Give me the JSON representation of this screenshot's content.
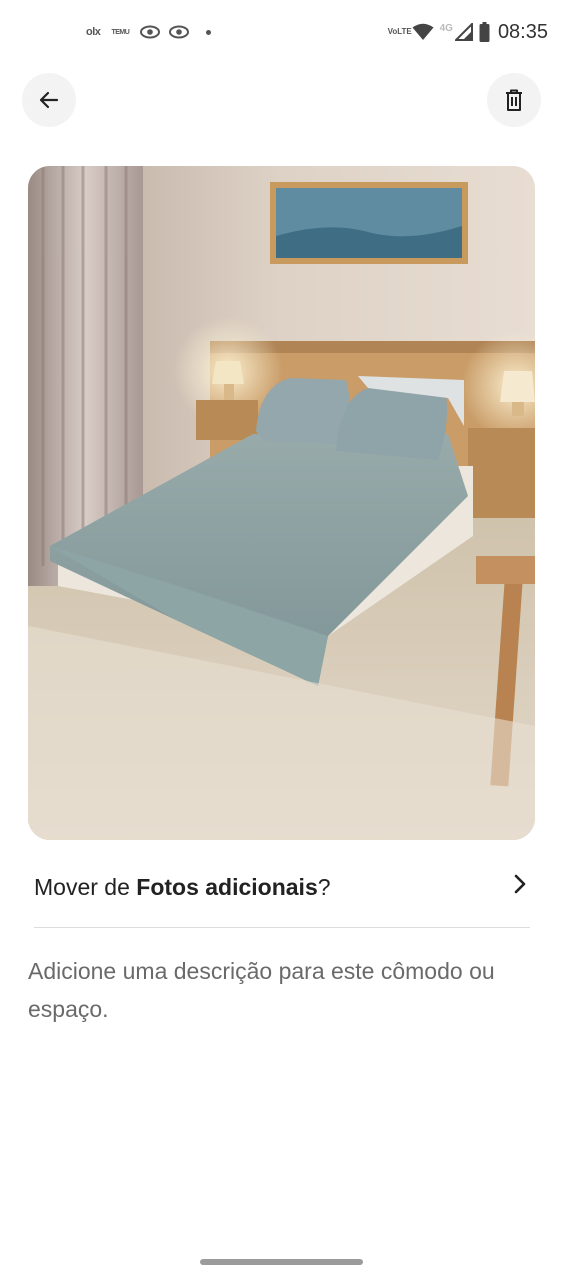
{
  "status_bar": {
    "notifications": [
      "olx-icon",
      "temu-icon",
      "eye-app-icon",
      "eye-app-icon",
      "more-dot-icon"
    ],
    "olx_label": "olx",
    "temu_label": "TEMU",
    "volte_label": "VoLTE",
    "network_label": "4G",
    "time": "08:35"
  },
  "header": {
    "back_icon": "arrow-left-icon",
    "delete_icon": "trash-icon"
  },
  "photo": {
    "subject": "bedroom-photo"
  },
  "move": {
    "prefix": "Mover de ",
    "category": "Fotos adicionais",
    "suffix": "?"
  },
  "description": {
    "placeholder": "Adicione uma descrição para este cômodo ou espaço."
  }
}
